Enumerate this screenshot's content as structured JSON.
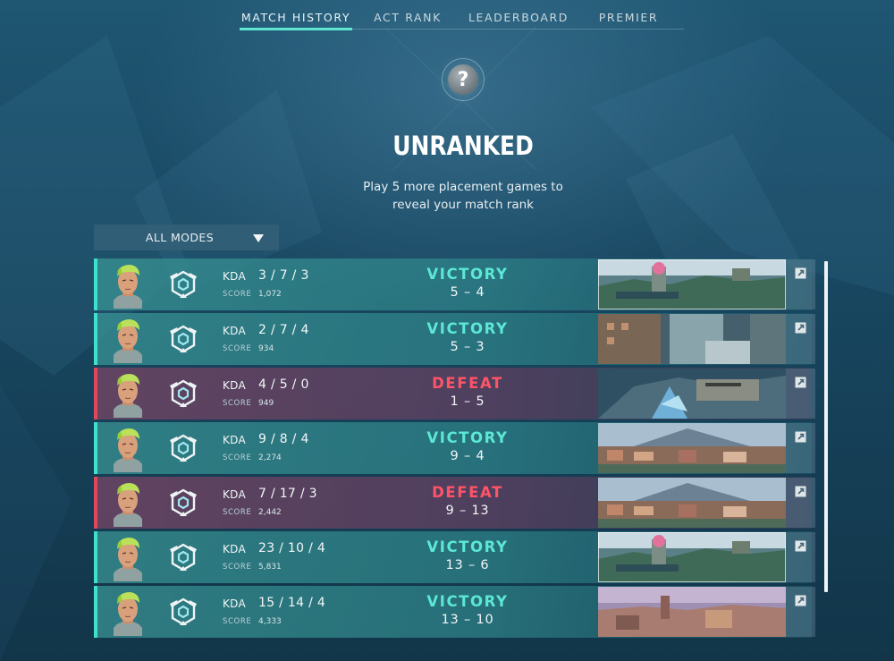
{
  "nav": {
    "tabs": [
      {
        "label": "MATCH HISTORY",
        "active": true
      },
      {
        "label": "ACT RANK",
        "active": false
      },
      {
        "label": "LEADERBOARD",
        "active": false
      },
      {
        "label": "PREMIER",
        "active": false
      }
    ]
  },
  "rank": {
    "badge_symbol": "?",
    "title": "UNRANKED",
    "subtitle_line1": "Play 5 more placement games to",
    "subtitle_line2": "reveal your match rank"
  },
  "filter": {
    "selected": "ALL MODES",
    "icon": "chevron-down-icon"
  },
  "labels": {
    "kda": "KDA",
    "score": "SCORE"
  },
  "colors": {
    "victory": "#5ce8d4",
    "defeat": "#ff5468",
    "accent": "#5ee6d2"
  },
  "matches": [
    {
      "result": "VICTORY",
      "kda": "3 / 7 / 3",
      "score": "1,072",
      "round_score": "5 – 4",
      "map": "map-pink-tower",
      "selected": true
    },
    {
      "result": "VICTORY",
      "kda": "2 / 7 / 4",
      "score": "934",
      "round_score": "5 – 3",
      "map": "map-urban-block",
      "selected": false
    },
    {
      "result": "DEFEAT",
      "kda": "4 / 5 / 0",
      "score": "949",
      "round_score": "1 – 5",
      "map": "map-blue-ice",
      "selected": false
    },
    {
      "result": "VICTORY",
      "kda": "9 / 8 / 4",
      "score": "2,274",
      "round_score": "9 – 4",
      "map": "map-coastal-town",
      "selected": false
    },
    {
      "result": "DEFEAT",
      "kda": "7 / 17 / 3",
      "score": "2,442",
      "round_score": "9 – 13",
      "map": "map-coastal-town",
      "selected": false
    },
    {
      "result": "VICTORY",
      "kda": "23 / 10 / 4",
      "score": "5,831",
      "round_score": "13 – 6",
      "map": "map-pink-tower",
      "selected": true
    },
    {
      "result": "VICTORY",
      "kda": "15 / 14 / 4",
      "score": "4,333",
      "round_score": "13 – 10",
      "map": "map-purple-city",
      "selected": false
    }
  ]
}
